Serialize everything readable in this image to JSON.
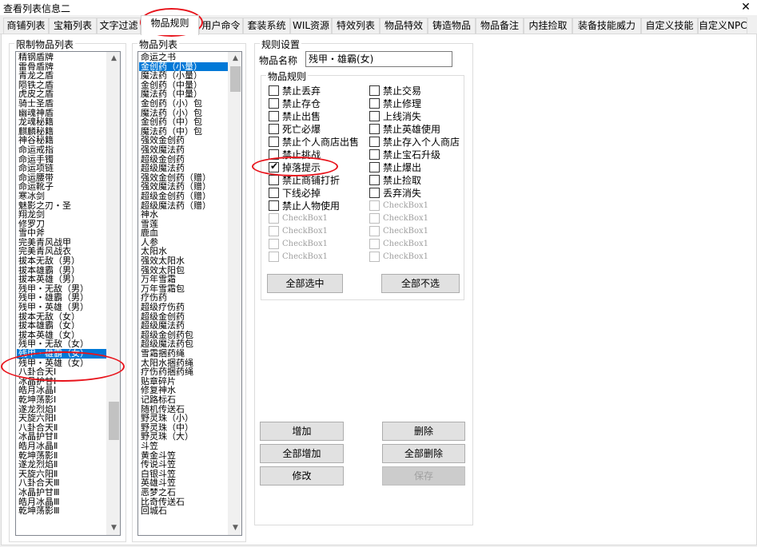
{
  "window": {
    "title": "查看列表信息二",
    "close": "✕"
  },
  "tabs": [
    "商铺列表",
    "宝箱列表",
    "文字过滤",
    "物品规则",
    "用户命令",
    "套装系统",
    "WIL资源",
    "特效列表",
    "物品特效",
    "铸造物品",
    "物品备注",
    "内挂捡取",
    "装备技能威力",
    "自定义技能",
    "自定义NPC"
  ],
  "active_tab": 3,
  "restricted_list": {
    "label": "限制物品列表",
    "items": [
      "精钢盾牌",
      "雷骨盾牌",
      "青龙之盾",
      "陨铁之盾",
      "虎皮之盾",
      "骑士圣盾",
      "幽魂神盾",
      "龙魂秘籍",
      "麒麟秘籍",
      "神谷秘籍",
      "命运戒指",
      "命运手镯",
      "命运项链",
      "命运腰带",
      "命运靴子",
      "寒冰剑",
      "魅影之刃・圣",
      "翔龙剑",
      "修罗刀",
      "雪中斧",
      "完美青风战甲",
      "完美青风战衣",
      "拔本无敌（男）",
      "拔本雄霸（男）",
      "拔本英雄（男）",
      "残甲・无敌（男）",
      "残甲・雄霸（男）",
      "残甲・英雄（男）",
      "拔本无敌（女）",
      "拔本雄霸（女）",
      "拔本英雄（女）",
      "残甲・无敌（女）",
      "残甲・雄霸（女）",
      "残甲・英雄（女）",
      "八卦合天Ⅰ",
      "冰晶护甘Ⅰ",
      "皓月冰晶Ⅰ",
      "乾坤荡影Ⅰ",
      "遂龙烈焰Ⅰ",
      "天旋六阳Ⅰ",
      "八卦合天Ⅱ",
      "冰晶护甘Ⅱ",
      "皓月冰晶Ⅱ",
      "乾坤荡影Ⅱ",
      "遂龙烈焰Ⅱ",
      "天旋六阳Ⅱ",
      "八卦合天Ⅲ",
      "冰晶护甘Ⅲ",
      "皓月冰晶Ⅲ",
      "乾坤荡影Ⅲ"
    ],
    "selected": 32
  },
  "item_list": {
    "label": "物品列表",
    "items": [
      "命运之书",
      "金创药（小量）",
      "魔法药（小量）",
      "金创药（中量）",
      "魔法药（中量）",
      "金创药（小）包",
      "魔法药（小）包",
      "金创药（中）包",
      "魔法药（中）包",
      "强效金创药",
      "强效魔法药",
      "超级金创药",
      "超级魔法药",
      "强效金创药（赠）",
      "强效魔法药（赠）",
      "超级金创药（赠）",
      "超级魔法药（赠）",
      "神水",
      "雪莲",
      "鹿血",
      "人参",
      "太阳水",
      "强效太阳水",
      "强效太阳包",
      "万年雪霜",
      "万年雪霜包",
      "疗伤药",
      "超级疗伤药",
      "超级金创药",
      "超级魔法药",
      "超级金创药包",
      "超级魔法药包",
      "雪霜捆药绳",
      "太阳水捆药绳",
      "疗伤药捆药绳",
      "贴章碎片",
      "修复神水",
      "记路标石",
      "随机传送石",
      "野灵珠（小）",
      "野灵珠（中）",
      "野灵珠（大）",
      "斗笠",
      "黄金斗笠",
      "传说斗笠",
      "白银斗笠",
      "英雄斗笠",
      "恶梦之石",
      "比奇传送石",
      "回城石"
    ],
    "selected": 1
  },
  "rules": {
    "group_label": "规则设置",
    "name_label": "物品名称",
    "name_value": "残甲・雄霸(女)",
    "sub_label": "物品规则",
    "left": [
      {
        "label": "禁止丢弃",
        "checked": false,
        "disabled": false
      },
      {
        "label": "禁止存仓",
        "checked": false,
        "disabled": false
      },
      {
        "label": "禁止出售",
        "checked": false,
        "disabled": false
      },
      {
        "label": "死亡必爆",
        "checked": false,
        "disabled": false
      },
      {
        "label": "禁止个人商店出售",
        "checked": false,
        "disabled": false
      },
      {
        "label": "禁止挑战",
        "checked": false,
        "disabled": false
      },
      {
        "label": "掉落提示",
        "checked": true,
        "disabled": false
      },
      {
        "label": "禁止商铺打折",
        "checked": false,
        "disabled": false
      },
      {
        "label": "下线必掉",
        "checked": false,
        "disabled": false
      },
      {
        "label": "禁止人物使用",
        "checked": false,
        "disabled": false
      },
      {
        "label": "CheckBox1",
        "checked": false,
        "disabled": true
      },
      {
        "label": "CheckBox1",
        "checked": false,
        "disabled": true
      },
      {
        "label": "CheckBox1",
        "checked": false,
        "disabled": true
      },
      {
        "label": "CheckBox1",
        "checked": false,
        "disabled": true
      }
    ],
    "right": [
      {
        "label": "禁止交易",
        "checked": false,
        "disabled": false
      },
      {
        "label": "禁止修理",
        "checked": false,
        "disabled": false
      },
      {
        "label": "上线消失",
        "checked": false,
        "disabled": false
      },
      {
        "label": "禁止英雄使用",
        "checked": false,
        "disabled": false
      },
      {
        "label": "禁止存入个人商店",
        "checked": false,
        "disabled": false
      },
      {
        "label": "禁止宝石升级",
        "checked": false,
        "disabled": false
      },
      {
        "label": "禁止爆出",
        "checked": false,
        "disabled": false
      },
      {
        "label": "禁止捡取",
        "checked": false,
        "disabled": false
      },
      {
        "label": "丢弃消失",
        "checked": false,
        "disabled": false
      },
      {
        "label": "CheckBox1",
        "checked": false,
        "disabled": true
      },
      {
        "label": "CheckBox1",
        "checked": false,
        "disabled": true
      },
      {
        "label": "CheckBox1",
        "checked": false,
        "disabled": true
      },
      {
        "label": "CheckBox1",
        "checked": false,
        "disabled": true
      },
      {
        "label": "CheckBox1",
        "checked": false,
        "disabled": true
      }
    ],
    "select_all": "全部选中",
    "select_none": "全部不选"
  },
  "actions": {
    "add": "增加",
    "delete": "删除",
    "add_all": "全部增加",
    "delete_all": "全部删除",
    "modify": "修改",
    "save": "保存"
  },
  "colors": {
    "selection": "#0078d7",
    "annotation": "#e8141c"
  }
}
